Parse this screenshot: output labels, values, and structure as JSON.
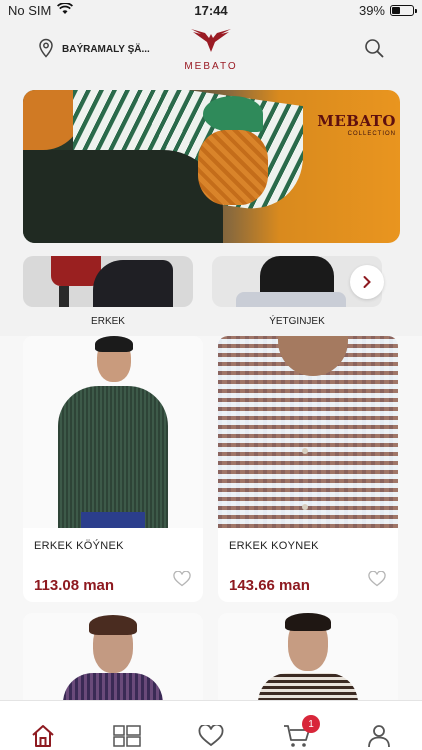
{
  "status_bar": {
    "carrier": "No SIM",
    "time": "17:44",
    "battery": "39%",
    "battery_level": 0.39
  },
  "header": {
    "location": "BAÝRAMALY ŞÄ...",
    "logo_text": "MEBATO",
    "icons": [
      "location-pin-icon",
      "eagle-logo",
      "search-icon"
    ]
  },
  "banner": {
    "brand": "MEBATO",
    "brand_sub": "COLLECTION"
  },
  "categories": [
    {
      "label": "ERKEK"
    },
    {
      "label": "ÝETGINJEK"
    }
  ],
  "products": [
    {
      "name": "ERKEK KÖÝNEK",
      "price": "113.08 man"
    },
    {
      "name": "ERKEK KOYNEK",
      "price": "143.66 man"
    }
  ],
  "nav": {
    "items": [
      "home-icon",
      "catalog-icon",
      "favorites-icon",
      "cart-icon",
      "profile-icon"
    ],
    "cart_badge": "1",
    "active": "home-icon"
  },
  "colors": {
    "accent": "#9a1b24",
    "price": "#8e1a20",
    "badge": "#d8263a"
  }
}
